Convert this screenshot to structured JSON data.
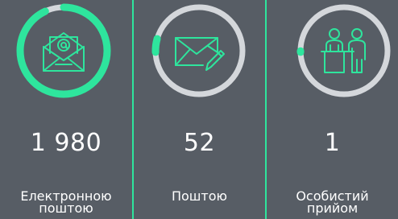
{
  "stats": [
    {
      "icon": "email-envelope-icon",
      "count": "1 980",
      "label_lines": [
        "Електронною",
        "поштою"
      ],
      "progress": 0.93
    },
    {
      "icon": "letter-pen-icon",
      "count": "52",
      "label_lines": [
        "Поштою"
      ],
      "progress": 0.05
    },
    {
      "icon": "reception-people-icon",
      "count": "1",
      "label_lines": [
        "Особистий",
        "прийом"
      ],
      "progress": 0.005
    }
  ],
  "colors": {
    "background": "#575d65",
    "accent": "#2ee59d",
    "ring_track": "#d4d7db"
  }
}
